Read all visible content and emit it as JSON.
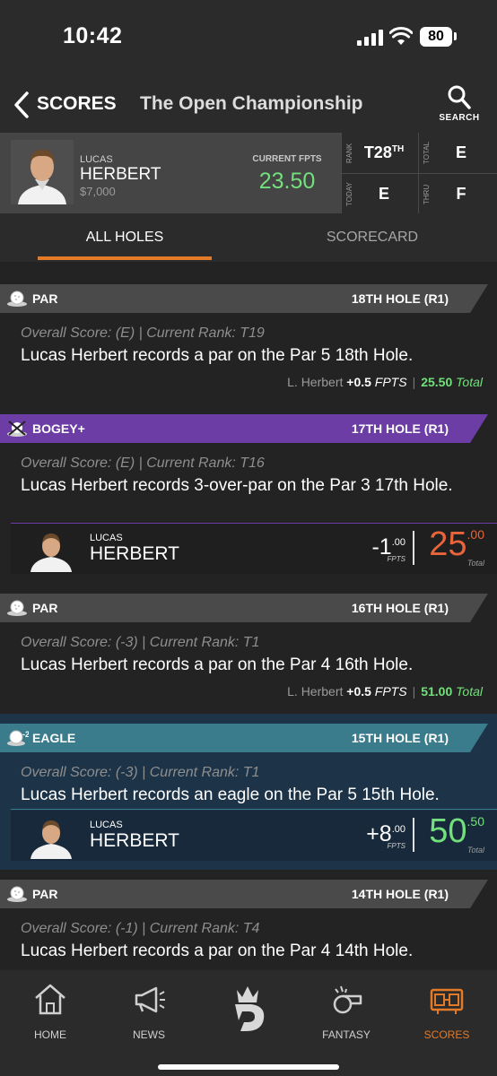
{
  "status_bar": {
    "time": "10:42",
    "battery": "80"
  },
  "header": {
    "back_label": "SCORES",
    "title": "The Open Championship",
    "search_label": "SEARCH"
  },
  "player": {
    "first_name": "LUCAS",
    "last_name": "HERBERT",
    "salary": "$7,000",
    "fpts_label": "CURRENT FPTS",
    "fpts": "23.50",
    "stats": {
      "rank_label": "RANK",
      "rank": "T28",
      "rank_suffix": "TH",
      "total_label": "TOTAL",
      "total": "E",
      "today_label": "TODAY",
      "today": "E",
      "thru_label": "THRU",
      "thru": "F"
    }
  },
  "tabs": [
    {
      "label": "ALL HOLES",
      "active": true
    },
    {
      "label": "SCORECARD",
      "active": false
    }
  ],
  "events": [
    {
      "type": "PAR",
      "hole": "18TH HOLE (R1)",
      "sub": "Overall Score: (E) | Current Rank: T19",
      "desc": "Lucas Herbert records a par on the Par 5 18th Hole.",
      "fpts_player": "L. Herbert",
      "fpts_change": "+0.5",
      "fpts_unit": "FPTS",
      "total": "25.50",
      "total_label": "Total"
    },
    {
      "type": "BOGEY+",
      "hole": "17TH HOLE (R1)",
      "sub": "Overall Score: (E) | Current Rank: T16",
      "desc": "Lucas Herbert records 3-over-par on the Par 3 17th Hole.",
      "impact": {
        "first": "LUCAS",
        "last": "HERBERT",
        "delta_int": "-1",
        "delta_dec": ".00",
        "delta_unit": "FPTS",
        "total_int": "25",
        "total_dec": ".00",
        "total_unit": "Total"
      }
    },
    {
      "type": "PAR",
      "hole": "16TH HOLE (R1)",
      "sub": "Overall Score: (-3) | Current Rank: T1",
      "desc": "Lucas Herbert records a par on the Par 4 16th Hole.",
      "fpts_player": "L. Herbert",
      "fpts_change": "+0.5",
      "fpts_unit": "FPTS",
      "total": "51.00",
      "total_label": "Total"
    },
    {
      "type": "EAGLE",
      "hole": "15TH HOLE (R1)",
      "sub": "Overall Score: (-3) | Current Rank: T1",
      "desc": "Lucas Herbert records an eagle on the Par 5 15th Hole.",
      "impact": {
        "first": "LUCAS",
        "last": "HERBERT",
        "delta_int": "+8",
        "delta_dec": ".00",
        "delta_unit": "FPTS",
        "total_int": "50",
        "total_dec": ".50",
        "total_unit": "Total"
      }
    },
    {
      "type": "PAR",
      "hole": "14TH HOLE (R1)",
      "sub": "Overall Score: (-1) | Current Rank: T4",
      "desc": "Lucas Herbert records a par on the Par 4 14th Hole."
    }
  ],
  "tabbar": [
    {
      "label": "HOME",
      "icon": "home-icon"
    },
    {
      "label": "NEWS",
      "icon": "megaphone-icon"
    },
    {
      "label": "",
      "icon": "draftkings-logo-icon"
    },
    {
      "label": "FANTASY",
      "icon": "whistle-icon"
    },
    {
      "label": "SCORES",
      "icon": "scoreboard-icon",
      "active": true
    }
  ],
  "colors": {
    "accent_orange": "#e37a28",
    "positive_green": "#72e07c",
    "negative_red": "#e8643a",
    "bogey_purple": "#6c3ea5",
    "eagle_teal": "#3a7b8c",
    "eagle_row_bg": "#1d3347",
    "par_header": "#4a4a4a"
  }
}
